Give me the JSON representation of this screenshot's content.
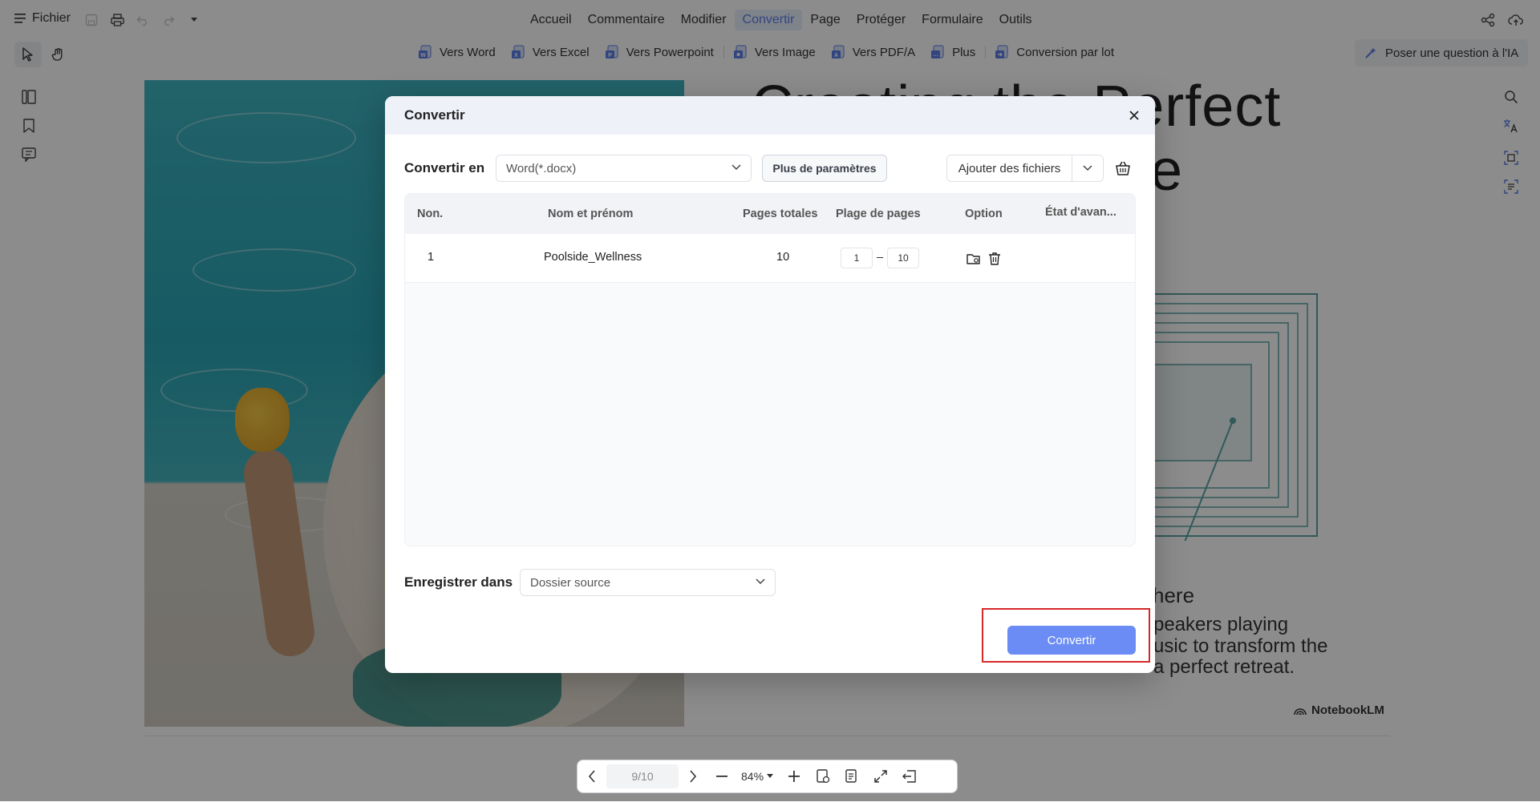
{
  "menubar": {
    "file_label": "Fichier",
    "items": [
      {
        "label": "Accueil",
        "active": false
      },
      {
        "label": "Commentaire",
        "active": false
      },
      {
        "label": "Modifier",
        "active": false
      },
      {
        "label": "Convertir",
        "active": true
      },
      {
        "label": "Page",
        "active": false
      },
      {
        "label": "Protéger",
        "active": false
      },
      {
        "label": "Formulaire",
        "active": false
      },
      {
        "label": "Outils",
        "active": false
      }
    ]
  },
  "convert_toolbar": {
    "items": [
      "Vers Word",
      "Vers Excel",
      "Vers Powerpoint",
      "Vers Image",
      "Vers PDF/A",
      "Plus",
      "Conversion par lot"
    ],
    "ai_button": "Poser une question à l'IA"
  },
  "document": {
    "title_line1": "Creating the Perfect",
    "title_line2": "ce",
    "here_word": "here",
    "body_lines": [
      "peakers playing",
      "usic to transform the",
      "a perfect retreat."
    ],
    "logo_text": "NotebookLM"
  },
  "page_nav": {
    "page": "9/10",
    "zoom": "84%"
  },
  "dialog": {
    "title": "Convertir",
    "convert_to_label": "Convertir en",
    "format_value": "Word(*.docx)",
    "more_settings": "Plus de paramètres",
    "add_files": "Ajouter des fichiers",
    "table": {
      "headers": [
        "Non.",
        "Nom et prénom",
        "Pages totales",
        "Plage de pages",
        "Option",
        "État d'avan..."
      ],
      "rows": [
        {
          "no": "1",
          "name": "Poolside_Wellness",
          "total_pages": "10",
          "range_from": "1",
          "range_to": "10"
        }
      ]
    },
    "save_in_label": "Enregistrer dans",
    "save_in_value": "Dossier source",
    "convert_button": "Convertir"
  },
  "colors": {
    "accent": "#5b7fe8",
    "primary_button": "#6b8cf4",
    "highlight": "#d62828"
  }
}
